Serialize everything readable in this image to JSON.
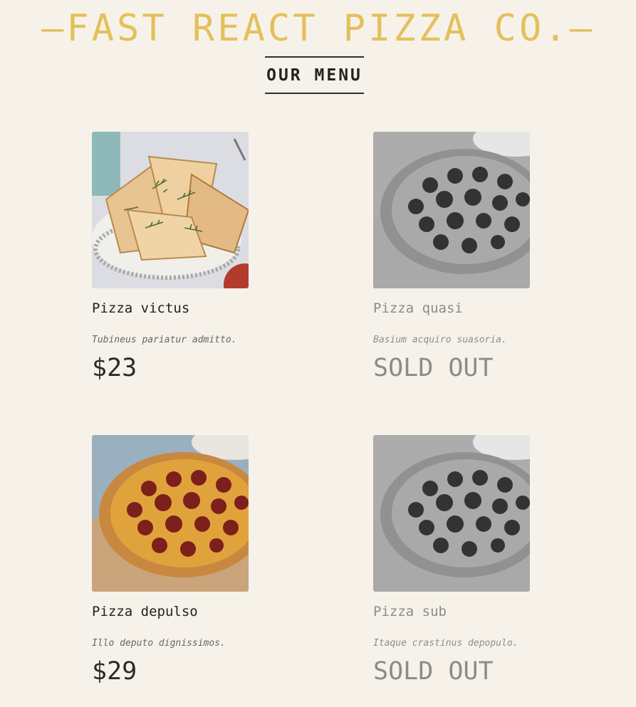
{
  "brand": "—FAST REACT PIZZA CO.—",
  "menu_title": "OUR MENU",
  "items": [
    {
      "name": "Pizza victus",
      "description": "Tubineus pariatur admitto.",
      "price": "$23",
      "sold_out": false,
      "image": "focaccia-basket"
    },
    {
      "name": "Pizza quasi",
      "description": "Basium acquiro suasoria.",
      "price": "SOLD OUT",
      "sold_out": true,
      "image": "pepperoni-pizza-grayscale"
    },
    {
      "name": "Pizza depulso",
      "description": "Illo deputo dignissimos.",
      "price": "$29",
      "sold_out": false,
      "image": "pepperoni-pizza"
    },
    {
      "name": "Pizza sub",
      "description": "Itaque crastinus depopulo.",
      "price": "SOLD OUT",
      "sold_out": true,
      "image": "pepperoni-pizza-grayscale"
    }
  ],
  "colors": {
    "background": "#f7f2e9",
    "brand": "#e4c05b",
    "text": "#222222",
    "muted": "#8b8b8b"
  }
}
